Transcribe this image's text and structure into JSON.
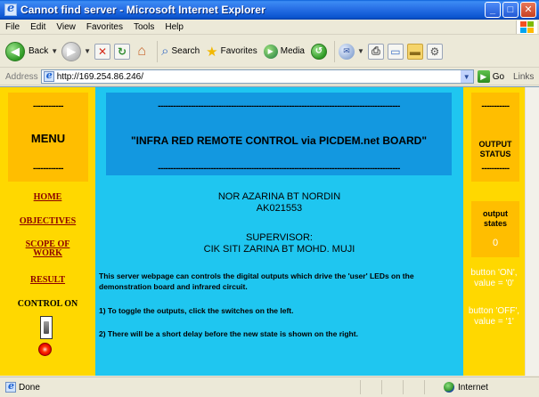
{
  "window": {
    "title": "Cannot find server - Microsoft Internet Explorer",
    "buttons": {
      "minimize": "_",
      "maximize": "□",
      "close": "✕"
    }
  },
  "menubar": [
    "File",
    "Edit",
    "View",
    "Favorites",
    "Tools",
    "Help"
  ],
  "toolbar": {
    "back_label": "Back",
    "search_label": "Search",
    "favorites_label": "Favorites",
    "media_label": "Media"
  },
  "addressbar": {
    "label": "Address",
    "url": "http://169.254.86.246/",
    "go_label": "Go",
    "links_label": "Links"
  },
  "left": {
    "dashes": "------------",
    "menu_title": "MENU",
    "nav": [
      "HOME",
      "OBJECTIVES",
      "SCOPE OF WORK",
      "RESULT"
    ],
    "control_label": "CONTROL ON"
  },
  "center": {
    "dashes": "------------------------------------------------------------------------------------------------",
    "banner_title": "\"INFRA RED REMOTE CONTROL via PICDEM.net BOARD\"",
    "author_name": "NOR AZARINA BT NORDIN",
    "author_id": "AK021553",
    "supervisor_label": "SUPERVISOR:",
    "supervisor_name": "CIK SITI ZARINA BT MOHD. MUJI",
    "para1": "This server webpage can controls the digital outputs which drive the 'user' LEDs on the demonstration board and infrared circuit.",
    "para2": "1) To toggle the outputs, click the switches on the left.",
    "para3": "2) There will be a short delay before the new state is shown on the right."
  },
  "right": {
    "dashes": "-----------",
    "output_title": "OUTPUT STATUS",
    "states_title": "output states",
    "states_value": "0",
    "note_on": "button 'ON', value = '0'",
    "note_off": "button 'OFF', value = '1'"
  },
  "statusbar": {
    "left": "Done",
    "zone": "Internet"
  },
  "colors": {
    "yellow_column": "#FFD800",
    "orange_box": "#FFBE00",
    "cyan_body": "#1FC6F0",
    "blue_banner": "#1398E0",
    "link_color": "#8B0000"
  }
}
